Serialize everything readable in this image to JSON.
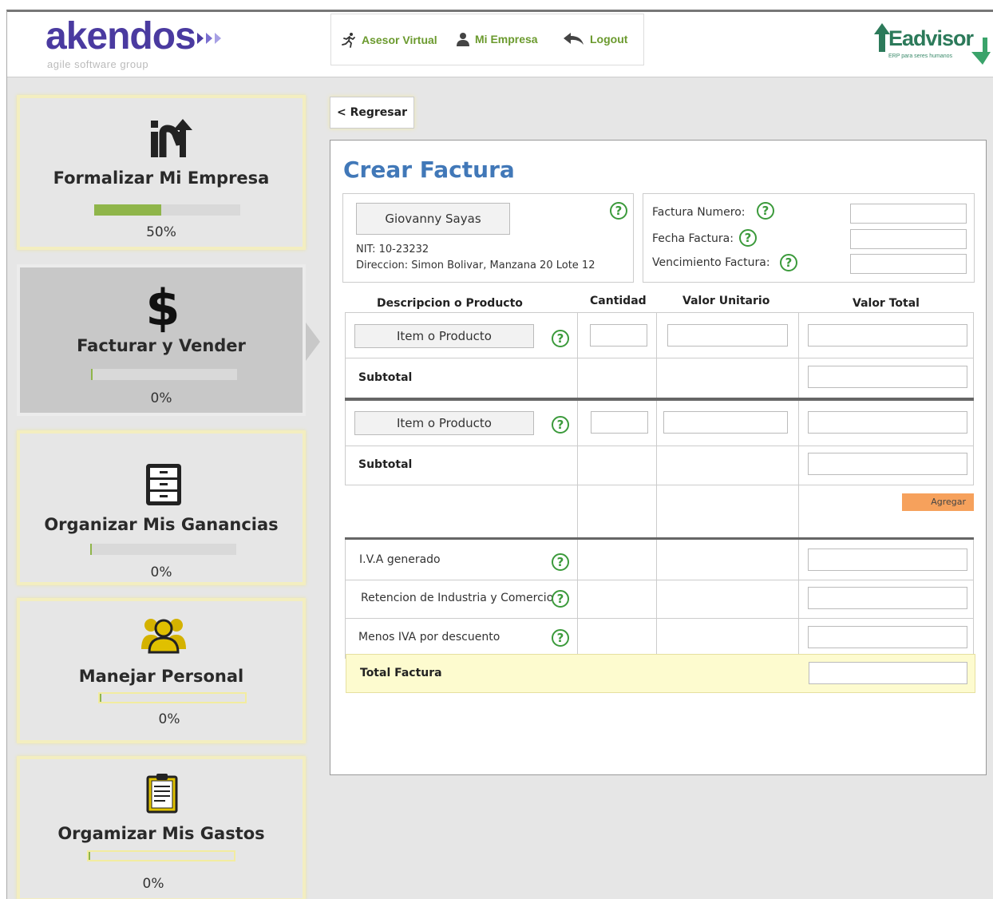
{
  "header": {
    "logo_text": "akendos",
    "logo_subtitle": "agile software group",
    "nav": {
      "asesor": "Asesor Virtual",
      "empresa": "Mi Empresa",
      "logout": "Logout"
    },
    "partner_logo": "Eadvisor",
    "partner_tagline": "ERP para seres humanos"
  },
  "sidebar": {
    "cards": [
      {
        "title": "Formalizar Mi Empresa",
        "progress": "50%",
        "progress_fraction": 0.5,
        "icon": "in-growth-icon"
      },
      {
        "title": "Facturar y Vender",
        "progress": "0%",
        "progress_fraction": 0,
        "icon": "dollar-icon",
        "active": true
      },
      {
        "title": "Organizar Mis Ganancias",
        "progress": "0%",
        "progress_fraction": 0,
        "icon": "cabinet-icon"
      },
      {
        "title": "Manejar Personal",
        "progress": "0%",
        "progress_fraction": 0,
        "icon": "people-icon"
      },
      {
        "title": "Orgamizar Mis Gastos",
        "progress": "0%",
        "progress_fraction": 0,
        "icon": "clipboard-icon"
      }
    ]
  },
  "back_button": "< Regresar",
  "invoice": {
    "title": "Crear Factura",
    "client": {
      "name": "Giovanny Sayas",
      "nit": "NIT: 10-23232",
      "address": "Direccion: Simon Bolivar, Manzana 20 Lote 12"
    },
    "meta": {
      "number_label": "Factura Numero:",
      "date_label": "Fecha Factura:",
      "due_label": "Vencimiento Factura:"
    },
    "columns": {
      "desc": "Descripcion o Producto",
      "qty": "Cantidad",
      "unit": "Valor Unitario",
      "total": "Valor Total"
    },
    "item_button": "Item o Producto",
    "subtotal": "Subtotal",
    "add_button": "Agregar",
    "taxes": {
      "iva": "I.V.A generado",
      "retencion": "Retencion de Industria y Comercio",
      "menos_iva": "Menos IVA por descuento"
    },
    "total_label": "Total Factura",
    "help_glyph": "?"
  },
  "colors": {
    "brand_purple": "#4a3aa0",
    "nav_green": "#6b9a2e",
    "title_blue": "#4178b8",
    "progress_green": "#8fb54a",
    "agregar_orange": "#f6a15c",
    "total_yellow": "#fdfbcf"
  }
}
